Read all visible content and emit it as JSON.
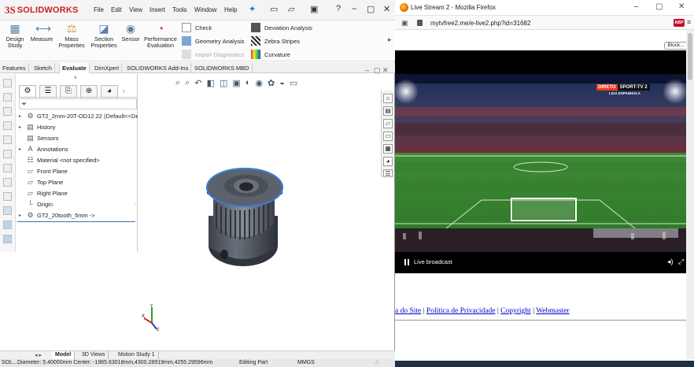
{
  "solidworks": {
    "logo": {
      "mark": "3S",
      "name": "SOLIDWORKS"
    },
    "menu": [
      "File",
      "Edit",
      "View",
      "Insert",
      "Tools",
      "Window",
      "Help"
    ],
    "ribbon": {
      "design_study": "Design Study",
      "measure": "Measure",
      "mass_properties": "Mass Properties",
      "section_properties": "Section Properties",
      "sensor": "Sensor",
      "performance_evaluation": "Performance Evaluation",
      "check": "Check",
      "geometry_analysis": "Geometry Analysis",
      "import_diagnostics": "Import Diagnostics",
      "deviation_analysis": "Deviation Analysis",
      "zebra_stripes": "Zebra Stripes",
      "curvature": "Curvature"
    },
    "tabs": [
      "Features",
      "Sketch",
      "Evaluate",
      "DimXpert",
      "SOLIDWORKS Add-Ins",
      "SOLIDWORKS MBD"
    ],
    "active_tab": "Evaluate",
    "feature_tree": {
      "root": "GT2_2mm-20T-OD12.22  (Default<<Def",
      "items": [
        "History",
        "Sensors",
        "Annotations",
        "Material <not specified>",
        "Front Plane",
        "Top Plane",
        "Right Plane",
        "Origin",
        "GT2_20tooth_5mm ->"
      ]
    },
    "bottom_tabs": [
      "Model",
      "3D Views",
      "Motion Study 1"
    ],
    "status": {
      "left": "SOL...",
      "diameter": "Diameter: 5.40000mm  Center: -1965.63018mm,4300.28919mm,4255.29596mm",
      "mode": "Editing Part",
      "units": "MMGS"
    }
  },
  "firefox": {
    "title": "Live Stream 2 - Mozilla Firefox",
    "url": "mytvfree2.me/e-live2.php?id=31682",
    "abp_label": "ABP",
    "block_button": "Block...",
    "player": {
      "live_label": "Live broadcast",
      "channel_badge": "DIRETO",
      "channel_name": "SPORT-TV 2",
      "league": "LIGA ESPANHOLA"
    },
    "footer": {
      "link1": "a do Site",
      "link2": "Política de Privacidade",
      "link3": "Copyright",
      "link4": "Webmaster",
      "sep": "|"
    }
  },
  "colors": {
    "sw_red": "#cc1f1f",
    "link_blue": "#0000cc",
    "pulley_edge": "#3b7fd1",
    "pulley_body": "#4f5560"
  }
}
